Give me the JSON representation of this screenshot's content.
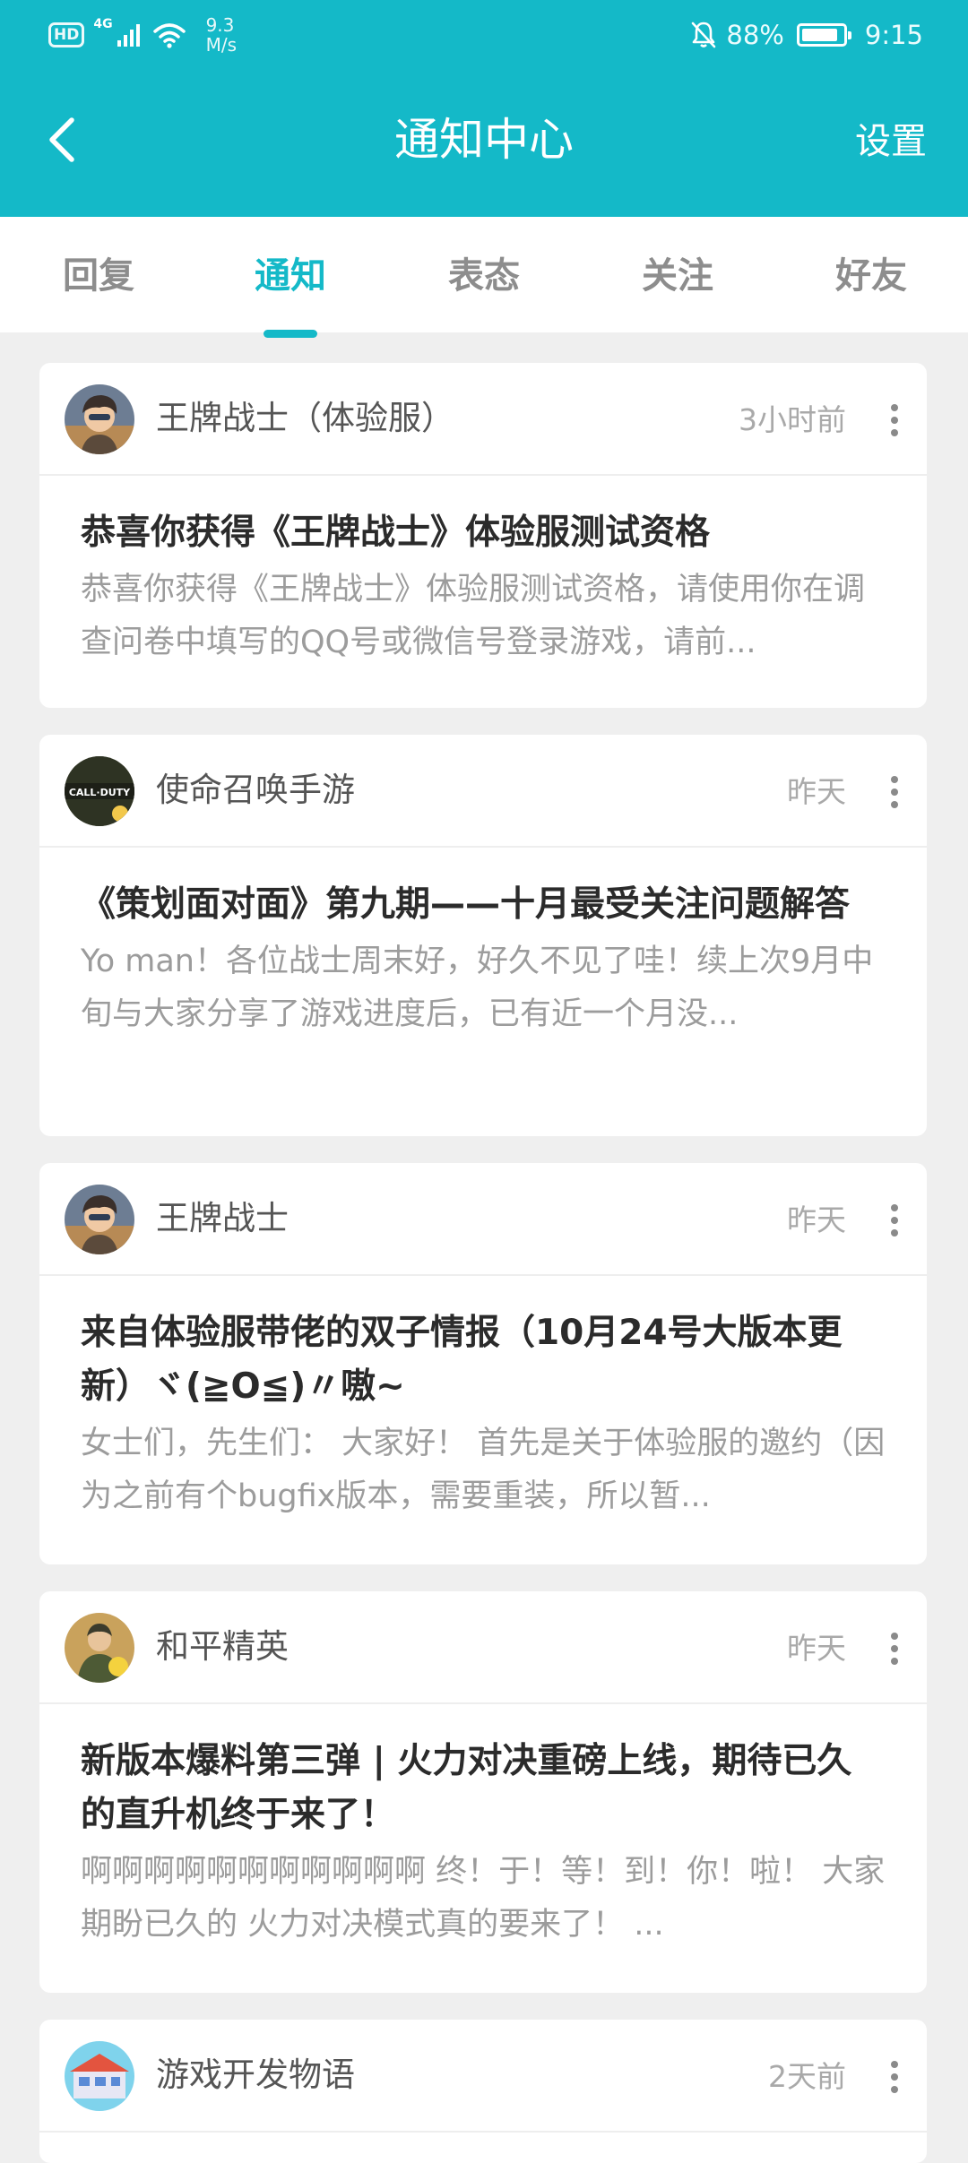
{
  "status_bar": {
    "hd_badge": "HD",
    "network_type": "4G",
    "speed_value": "9.3",
    "speed_unit": "M/s",
    "battery_percent": "88%",
    "battery_level": 0.88,
    "time": "9:15"
  },
  "header": {
    "title": "通知中心",
    "settings_label": "设置"
  },
  "colors": {
    "accent": "#14b9c8",
    "background": "#efefef"
  },
  "tabs": [
    {
      "label": "回复",
      "active": false
    },
    {
      "label": "通知",
      "active": true
    },
    {
      "label": "表态",
      "active": false
    },
    {
      "label": "关注",
      "active": false
    },
    {
      "label": "好友",
      "active": false
    }
  ],
  "notifications": [
    {
      "sender": "王牌战士（体验服）",
      "time": "3小时前",
      "avatar_icon": "soldier-avatar-icon",
      "title": "恭喜你获得《王牌战士》体验服测试资格",
      "preview": "恭喜你获得《王牌战士》体验服测试资格，请使用你在调查问卷中填写的QQ号或微信号登录游戏，请前..."
    },
    {
      "sender": "使命召唤手游",
      "time": "昨天",
      "avatar_icon": "call-of-duty-logo-icon",
      "avatar_text": "CALL·DUTY",
      "title": "《策划面对面》第九期——十月最受关注问题解答",
      "preview": "Yo man！各位战士周末好，好久不见了哇！续上次9月中旬与大家分享了游戏进度后，已有近一个月没..."
    },
    {
      "sender": "王牌战士",
      "time": "昨天",
      "avatar_icon": "soldier-avatar-icon",
      "title": "来自体验服带佬的双子情报（10月24号大版本更新）ヾ(≧O≦)〃嗷~",
      "preview": "女士们，先生们： 大家好！ 首先是关于体验服的邀约（因为之前有个bugfix版本，需要重装，所以暂..."
    },
    {
      "sender": "和平精英",
      "time": "昨天",
      "avatar_icon": "peace-elite-avatar-icon",
      "title": "新版本爆料第三弹 | 火力对决重磅上线，期待已久的直升机终于来了！",
      "preview": "啊啊啊啊啊啊啊啊啊啊啊 终！于！等！到！你！啦！ 大家期盼已久的 火力对决模式真的要来了！ ..."
    },
    {
      "sender": "游戏开发物语",
      "time": "2天前",
      "avatar_icon": "game-dev-story-avatar-icon"
    }
  ]
}
